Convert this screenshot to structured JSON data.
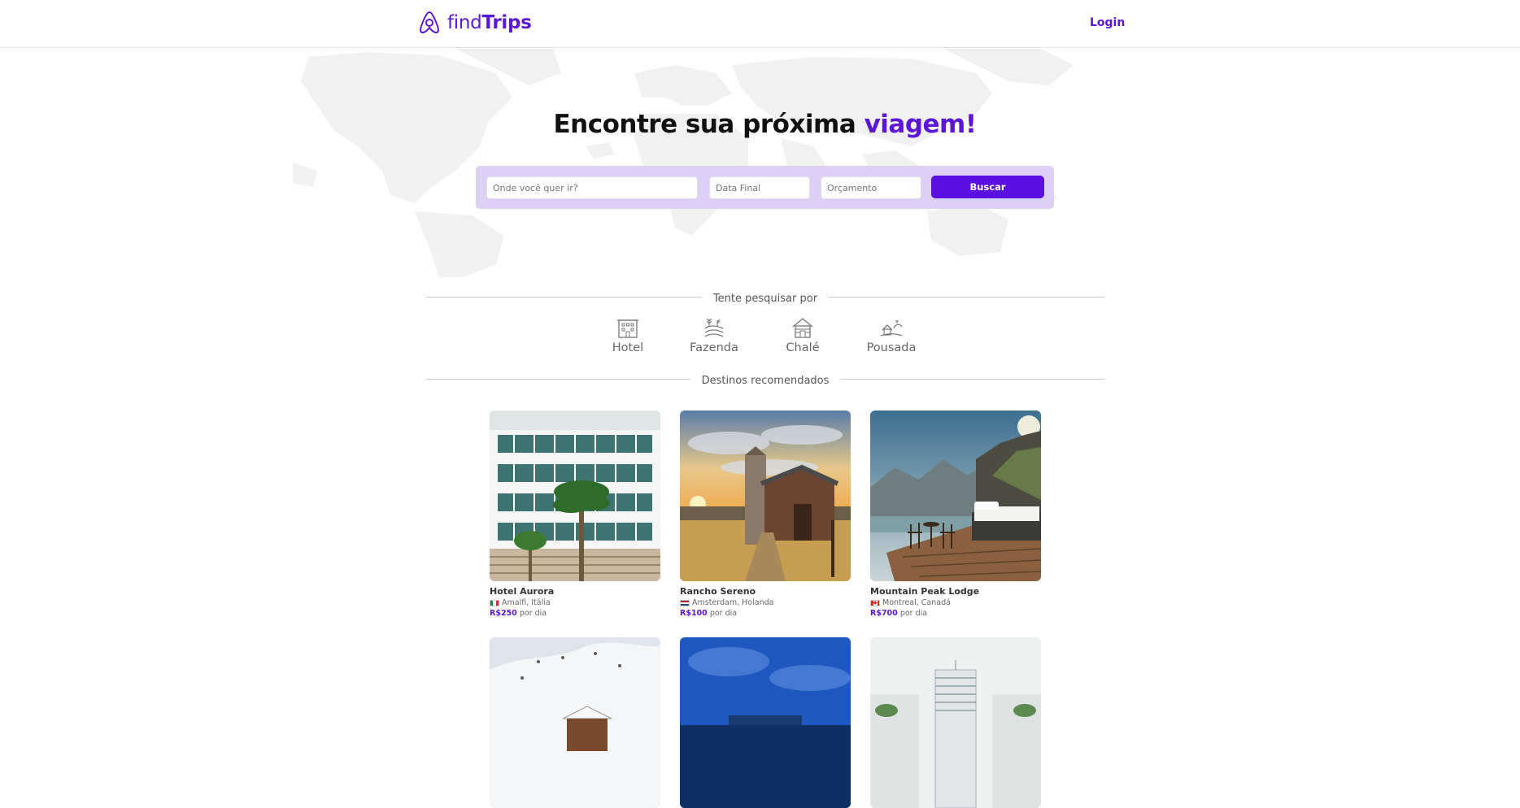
{
  "brand": {
    "name_plain": "find",
    "name_bold": "Trips",
    "color": "#5b16d8"
  },
  "nav": {
    "login_label": "Login"
  },
  "hero": {
    "headline_part1": "Encontre sua próxima ",
    "headline_accent": "viagem!"
  },
  "search": {
    "destination_placeholder": "Onde você quer ir?",
    "end_date_placeholder": "Data Final",
    "budget_placeholder": "Orçamento",
    "button_label": "Buscar"
  },
  "suggestions": {
    "heading": "Tente pesquisar por",
    "items": [
      {
        "label": "Hotel",
        "icon": "hotel-icon"
      },
      {
        "label": "Fazenda",
        "icon": "farm-icon"
      },
      {
        "label": "Chalé",
        "icon": "chalet-icon"
      },
      {
        "label": "Pousada",
        "icon": "inn-icon"
      }
    ]
  },
  "recommended": {
    "heading": "Destinos recomendados",
    "cards": [
      {
        "name": "Hotel Aurora",
        "location": "Amalfi, Itália",
        "flag": "italy-flag",
        "currency": "R$",
        "price": "250",
        "per": "por dia"
      },
      {
        "name": "Rancho Sereno",
        "location": "Amsterdam, Holanda",
        "flag": "netherlands-flag",
        "currency": "R$",
        "price": "100",
        "per": "por dia"
      },
      {
        "name": "Mountain Peak Lodge",
        "location": "Montreal, Canadá",
        "flag": "canada-flag",
        "currency": "R$",
        "price": "700",
        "per": "por dia"
      }
    ]
  }
}
